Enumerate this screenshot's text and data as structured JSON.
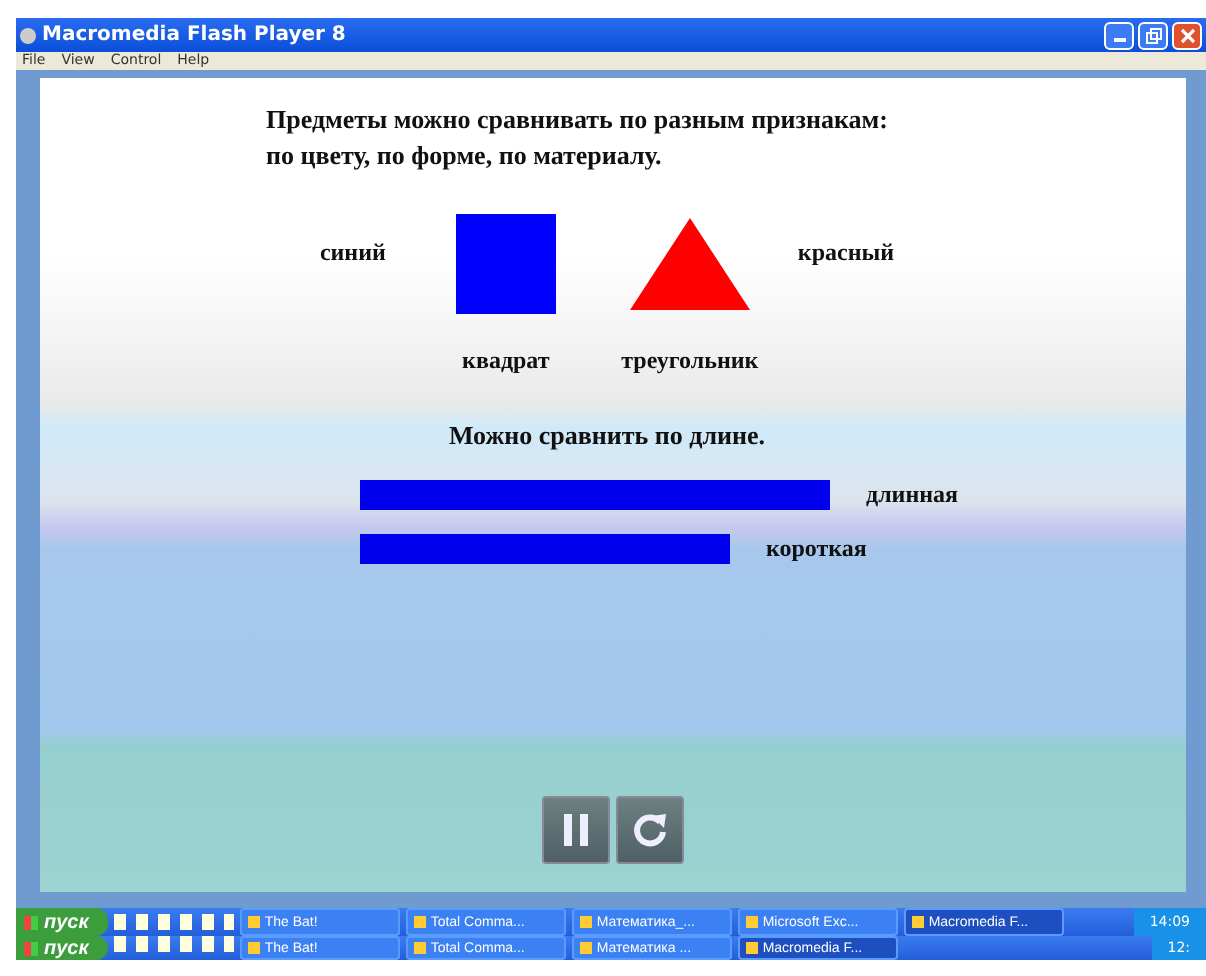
{
  "window": {
    "title": "Macromedia Flash Player 8"
  },
  "menu": [
    "File",
    "View",
    "Control",
    "Help"
  ],
  "stage": {
    "intro": [
      "Предметы можно сравнивать по разным признакам:",
      "по цвету,  по форме,  по материалу."
    ],
    "shapes": [
      {
        "kind": "square",
        "color": "#0000ff",
        "color_label": "синий",
        "name": "квадрат"
      },
      {
        "kind": "triangle",
        "color": "#ff0000",
        "color_label": "красный",
        "name": "треугольник"
      }
    ],
    "length_heading": "Можно сравнить по длине.",
    "bars": [
      {
        "kind": "long",
        "label": "длинная"
      },
      {
        "kind": "short",
        "label": "короткая"
      }
    ],
    "controls": [
      {
        "kind": "pause"
      },
      {
        "kind": "replay"
      }
    ]
  },
  "taskbars": [
    {
      "start": "пуск",
      "tasks": [
        {
          "label": "The Bat!",
          "selected": false
        },
        {
          "label": "Total Comma...",
          "selected": false
        },
        {
          "label": "Математика_...",
          "selected": false
        },
        {
          "label": "Microsoft Exc...",
          "selected": false
        },
        {
          "label": "Macromedia F...",
          "selected": true
        }
      ],
      "clock": "14:09"
    },
    {
      "start": "пуск",
      "tasks": [
        {
          "label": "The Bat!",
          "selected": false
        },
        {
          "label": "Total Comma...",
          "selected": false
        },
        {
          "label": "Математика ...",
          "selected": false
        },
        {
          "label": "Macromedia F...",
          "selected": true
        }
      ],
      "clock": "12:"
    }
  ]
}
